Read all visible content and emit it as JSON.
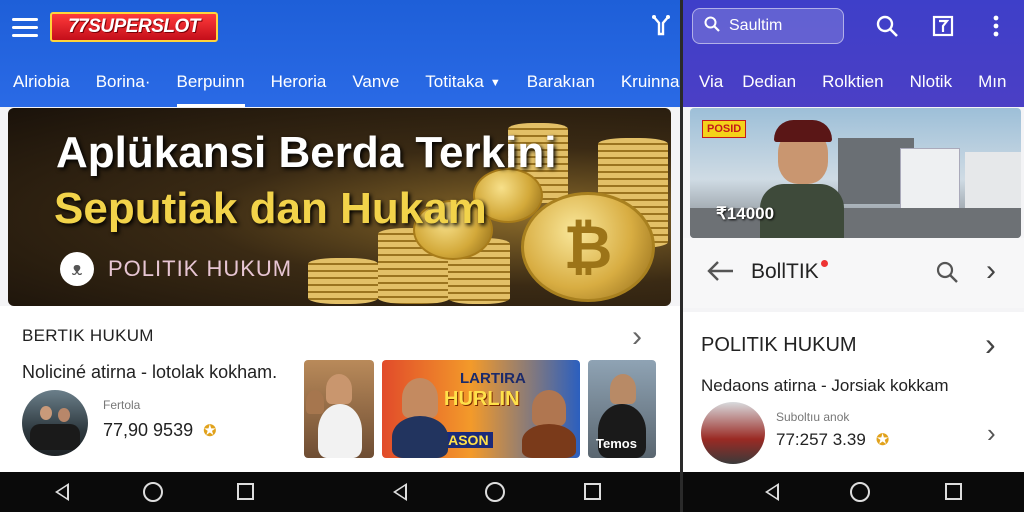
{
  "left": {
    "logo": "77SUPERSLOT",
    "tabs": [
      {
        "label": "Alriobia"
      },
      {
        "label": "Borina·"
      },
      {
        "label": "Berpuinn"
      },
      {
        "label": "Heroria"
      },
      {
        "label": "Vanve"
      },
      {
        "label": "Totitaka"
      },
      {
        "label": "Barakıan"
      },
      {
        "label": "Kruinnar"
      }
    ],
    "hero": {
      "title_line1": "Aplükansi Berda Terkini",
      "title_line2": "Seputiak dan Hukam",
      "category": "POLITIK HUKUM"
    },
    "card": {
      "heading": "BERTIK HUKUM",
      "subtitle": "Noliciné atirna - lotolak kokham.",
      "meta_label": "Fertola",
      "meta_value": "77,90 9539",
      "thumb_banner_line1": "LARTIRA",
      "thumb_banner_line2": "HURLIN",
      "thumb_banner_line3": "DASON",
      "thumb_caption": "Temos"
    }
  },
  "right": {
    "search_placeholder": "Saultim",
    "tabs": [
      {
        "label": "Via"
      },
      {
        "label": "Dedian"
      },
      {
        "label": "Rolktien"
      },
      {
        "label": "Nlotik"
      },
      {
        "label": "Mın"
      }
    ],
    "video": {
      "badge": "POSID",
      "price": "₹14000"
    },
    "strip_title": "BollTIK",
    "card": {
      "heading": "POLITIK HUKUM",
      "subtitle": "Nedaons atirna - Jorsiak kokkam",
      "meta_label": "Suboltıu anok",
      "meta_value": "77:257 3.39"
    }
  }
}
